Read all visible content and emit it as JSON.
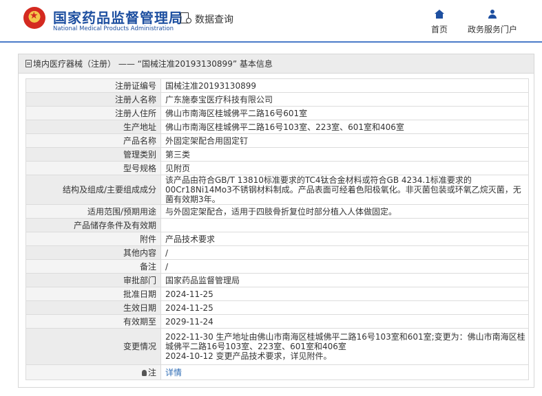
{
  "header": {
    "brand_cn": "国家药品监督管理局",
    "brand_en": "National Medical Products Administration",
    "query_label": "数据查询",
    "nav": [
      {
        "label": "首页",
        "icon": "home-icon"
      },
      {
        "label": "政务服务门户",
        "icon": "user-icon"
      }
    ]
  },
  "panel": {
    "title": "境内医疗器械（注册） —— “国械注准20193130899” 基本信息"
  },
  "rows": [
    {
      "key": "注册证编号",
      "value": "国械注准20193130899"
    },
    {
      "key": "注册人名称",
      "value": "广东施泰宝医疗科技有限公司"
    },
    {
      "key": "注册人住所",
      "value": "佛山市南海区桂城佛平二路16号601室"
    },
    {
      "key": "生产地址",
      "value": "佛山市南海区桂城佛平二路16号103室、223室、601室和406室"
    },
    {
      "key": "产品名称",
      "value": "外固定架配合用固定钉"
    },
    {
      "key": "管理类别",
      "value": "第三类"
    },
    {
      "key": "型号规格",
      "value": "见附页"
    },
    {
      "key": "结构及组成/主要组成成分",
      "value": "该产品由符合GB/T 13810标准要求的TC4钛合金材料或符合GB 4234.1标准要求的00Cr18Ni14Mo3不锈钢材料制成。产品表面可经着色阳极氧化。非灭菌包装或环氧乙烷灭菌，无菌有效期3年。"
    },
    {
      "key": "适用范围/预期用途",
      "value": "与外固定架配合，适用于四肢骨折复位时部分植入人体做固定。"
    },
    {
      "key": "产品储存条件及有效期",
      "value": ""
    },
    {
      "key": "附件",
      "value": "产品技术要求"
    },
    {
      "key": "其他内容",
      "value": "/"
    },
    {
      "key": "备注",
      "value": "/"
    },
    {
      "key": "审批部门",
      "value": "国家药品监督管理局"
    },
    {
      "key": "批准日期",
      "value": "2024-11-25"
    },
    {
      "key": "生效日期",
      "value": "2024-11-25"
    },
    {
      "key": "有效期至",
      "value": "2029-11-24"
    },
    {
      "key": "变更情况",
      "value": "2022-11-30 生产地址由佛山市南海区桂城佛平二路16号103室和601室;变更为：佛山市南海区桂城佛平二路16号103室、223室、601室和406室\n2024-10-12 变更产品技术要求，详见附件。"
    }
  ],
  "note_row": {
    "key": "注",
    "value": "详情"
  }
}
